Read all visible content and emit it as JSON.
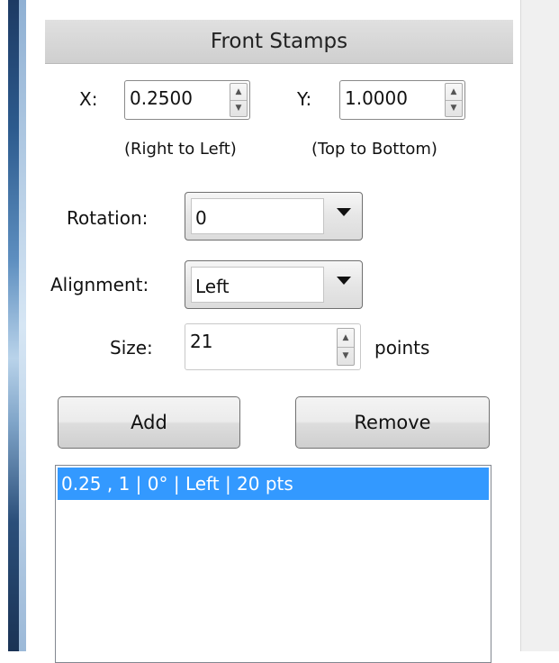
{
  "panel": {
    "title": "Front Stamps"
  },
  "position": {
    "x_label": "X:",
    "x_value": "0.2500",
    "x_hint": "(Right to Left)",
    "y_label": "Y:",
    "y_value": "1.0000",
    "y_hint": "(Top to Bottom)"
  },
  "rotation": {
    "label": "Rotation:",
    "value": "0"
  },
  "alignment": {
    "label": "Alignment:",
    "value": "Left"
  },
  "size": {
    "label": "Size:",
    "value": "21",
    "unit": "points"
  },
  "buttons": {
    "add": "Add",
    "remove": "Remove"
  },
  "stamps": [
    {
      "label": "0.25 , 1 | 0° | Left | 20 pts",
      "selected": true
    }
  ],
  "colors": {
    "selection": "#3399ff",
    "header": "#d6d6d6"
  },
  "icons": {
    "spin_up": "spin-up-arrow-icon",
    "spin_down": "spin-down-arrow-icon",
    "dropdown": "dropdown-caret-icon"
  }
}
